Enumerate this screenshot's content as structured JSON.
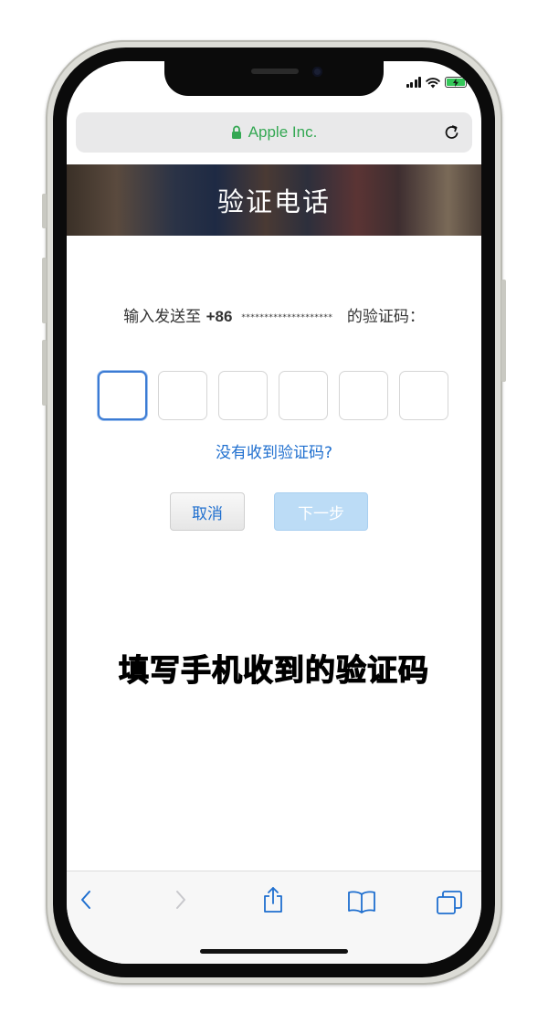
{
  "browser": {
    "url_label": "Apple Inc.",
    "lock_icon": "lock-icon",
    "reload_icon": "reload-icon"
  },
  "page": {
    "title": "验证电话"
  },
  "verification": {
    "prompt_prefix": "输入发送至 ",
    "country_code": "+86",
    "masked_number": "********************",
    "prompt_suffix": " 的验证码：",
    "code_length": 6,
    "resend_link": "没有收到验证码?",
    "cancel_label": "取消",
    "next_label": "下一步"
  },
  "caption": "填写手机收到的验证码",
  "toolbar": {
    "back_icon": "back-chevron-icon",
    "forward_icon": "forward-chevron-icon",
    "share_icon": "share-icon",
    "bookmarks_icon": "bookmarks-icon",
    "tabs_icon": "tabs-icon"
  },
  "colors": {
    "accent_blue": "#1f6fcf",
    "url_green": "#34a853",
    "next_disabled": "#bcdcf6"
  }
}
